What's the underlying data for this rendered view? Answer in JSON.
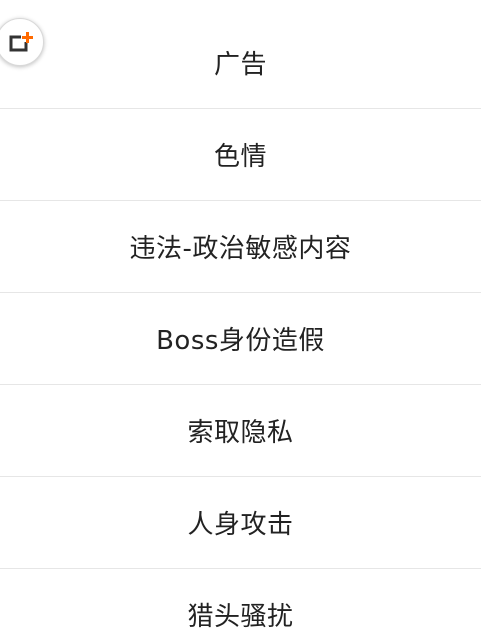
{
  "report_reasons": {
    "items": [
      {
        "label": "广告"
      },
      {
        "label": "色情"
      },
      {
        "label": "违法-政治敏感内容"
      },
      {
        "label": "Boss身份造假"
      },
      {
        "label": "索取隐私"
      },
      {
        "label": "人身攻击"
      },
      {
        "label": "猎头骚扰"
      }
    ]
  },
  "floating_button": {
    "icon": "add-frame-icon",
    "accent_color": "#ff6a00",
    "frame_color": "#333333"
  }
}
